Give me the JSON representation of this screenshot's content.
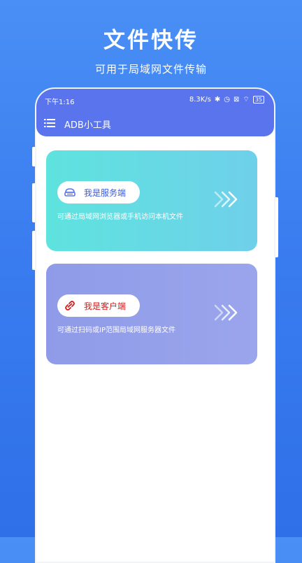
{
  "hero": {
    "title": "文件快传",
    "subtitle": "可用于局域网文件传输"
  },
  "status_bar": {
    "time": "下午1:16",
    "speed": "8.3K/s",
    "battery": "35"
  },
  "app_bar": {
    "title": "ADB小工具",
    "menu_icon": "menu-icon"
  },
  "cards": [
    {
      "label": "我是服务端",
      "description": "可通过局域网浏览器或手机访问本机文件",
      "icon": "server-icon",
      "label_color": "#3a5bd9"
    },
    {
      "label": "我是客户端",
      "description": "可通过扫码或IP范围局域网服务器文件",
      "icon": "link-icon",
      "label_color": "#d91a1a"
    }
  ],
  "colors": {
    "background": "#3a7df0",
    "app_bar": "#5a74ee",
    "server_card": "#62dde0",
    "client_card": "#949fea"
  }
}
